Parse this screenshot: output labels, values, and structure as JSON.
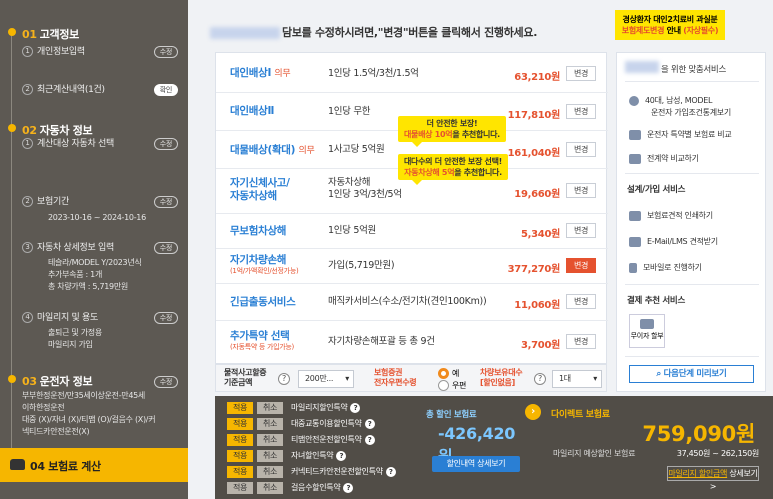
{
  "sidebar": {
    "s1_num": "01",
    "s1_title": "고객정보",
    "s1_sub": "개인정보입력",
    "s1_pill": "수정",
    "s1b_sub": "최근계산내역(1건)",
    "s1b_pill": "확인",
    "s2_num": "02",
    "s2_title": "자동차 정보",
    "s2_sub": "계산대상 자동차 선택",
    "s2_pill": "수정",
    "s2b_sub": "보험기간",
    "s2b_date": "2023-10-16 ~ 2024-10-16",
    "s2b_pill": "수정",
    "s2c_sub": "자동차 상세정보 입력",
    "s2c_l1": "테슬라/MODEL Y/2023년식",
    "s2c_l2": "추가부속품 : 1개",
    "s2c_l3": "총 차량가액 : 5,719만원",
    "s2c_pill": "수정",
    "s2d_sub": "마일리지 및 용도",
    "s2d_l1": "출퇴근 및 가정용",
    "s2d_l2": "마일리지 가입",
    "s2d_pill": "수정",
    "s3_num": "03",
    "s3_title": "운전자 정보",
    "s3_pill": "수정",
    "s3_l1": "부부한정운전/만35세이상운전-만45세",
    "s3_l2": "이하한정운전",
    "s3_l3": "대중 (X)/자녀 (X)/티맵 (O)/걸음수 (X)/커",
    "s3_l4": "넥티드카안전운전(X)",
    "s4_num": "04",
    "s4_title": "보험료 계산"
  },
  "header": {
    "text": "담보를 수정하시려면,\"변경\"버튼을 클릭해서 진행하세요.",
    "notice_l1": "경상환자 대인2치료비 과실분",
    "notice_l2a": "보험제도변경",
    "notice_l2b": "안내",
    "notice_l2c": "(자상필수)"
  },
  "coverage": [
    {
      "name": "대인배상Ⅰ",
      "opt": "의무",
      "desc": "1인당 1.5억/3천/1.5억",
      "price": "63,210원",
      "btn": "변경"
    },
    {
      "name": "대인배상Ⅱ",
      "opt": "",
      "desc": "1인당 무한",
      "price": "117,810원",
      "btn": "변경"
    },
    {
      "name": "대물배상(확대)",
      "opt": "의무",
      "desc": "1사고당 5억원",
      "price": "161,040원",
      "btn": "변경"
    },
    {
      "name1": "자기신체사고/",
      "name2": "자동차상해",
      "desc1": "자동차상해",
      "desc2": "1인당 3억/3천/5억",
      "price": "19,660원",
      "btn": "변경"
    },
    {
      "name": "무보험차상해",
      "desc": "1인당 5억원",
      "price": "5,340원",
      "btn": "변경"
    },
    {
      "name": "자기차량손해",
      "sub": "(1억/가액확인/선정가능)",
      "desc": "가입(5,719만원)",
      "price": "377,270원",
      "btn": "변경"
    },
    {
      "name": "긴급출동서비스",
      "desc": "매직카서비스(수소/전기차(견인100Km))",
      "price": "11,060원",
      "btn": "변경"
    },
    {
      "name": "추가특약 선택",
      "sub": "(자동특약 등 가입가능)",
      "desc": "자기차량손해포괄 등 총 9건",
      "price": "3,700원",
      "btn": "변경"
    }
  ],
  "tips": {
    "t1_l1": "더 안전한 보장!",
    "t1_l2a": "대물배상 10억",
    "t1_l2b": "을 추천합니다.",
    "t2_l1": "대다수의 더 안전한 보장 선택!",
    "t2_l2a": "자동차상해 5억",
    "t2_l2b": "을 추천합니다."
  },
  "options": {
    "l1a": "물적사고할증",
    "l1b": "기준금액",
    "sel1": "200만...",
    "l2a": "보험증권",
    "l2b": "전자우편수령",
    "r1": "예",
    "r2": "우편",
    "l3a": "차량보유대수",
    "l3b": "[할인없음]",
    "sel3": "1대"
  },
  "side": {
    "title_suffix": "을 위한 맞춤서비스",
    "profile1": "40대, 남성, MODEL",
    "profile2": "운전자 가입조건통계보기",
    "i1": "운전자 특약별 보험료 비교",
    "i2": "전계약 비교하기",
    "h2": "설계/가입 서비스",
    "i3": "보험료견적 인쇄하기",
    "i4": "E-Mail/LMS 견적받기",
    "i5": "모바일로 진행하기",
    "h3": "결제 추천 서비스",
    "i6": "무이자 할부",
    "next": "다음단계 미리보기"
  },
  "bottom": {
    "tags": [
      [
        "적용",
        "취소",
        "마일리지할인특약"
      ],
      [
        "적용",
        "취소",
        "대중교통이용할인특약"
      ],
      [
        "적용",
        "취소",
        "티맵안전운전할인특약"
      ],
      [
        "적용",
        "취소",
        "자녀할인특약"
      ],
      [
        "적용",
        "취소",
        "커넥티드카안전운전할인특약"
      ],
      [
        "적용",
        "취소",
        "걸음수할인특약"
      ]
    ],
    "disc_label": "총 할인 보험료",
    "disc_value": "-426,420원",
    "disc_btn": "할인내역 상세보기",
    "total_label": "다이렉트 보험료",
    "total_value": "759,090원",
    "mile_label": "마일리지 예상할인 보험료",
    "mile_value": "37,450원 ~ 262,150원",
    "detail_a": "마일리지 할인금액",
    "detail_b": "상세보기 >"
  },
  "colors": {
    "accent": "#f6b600",
    "blue": "#2a7fd4",
    "red": "#e5522f"
  }
}
